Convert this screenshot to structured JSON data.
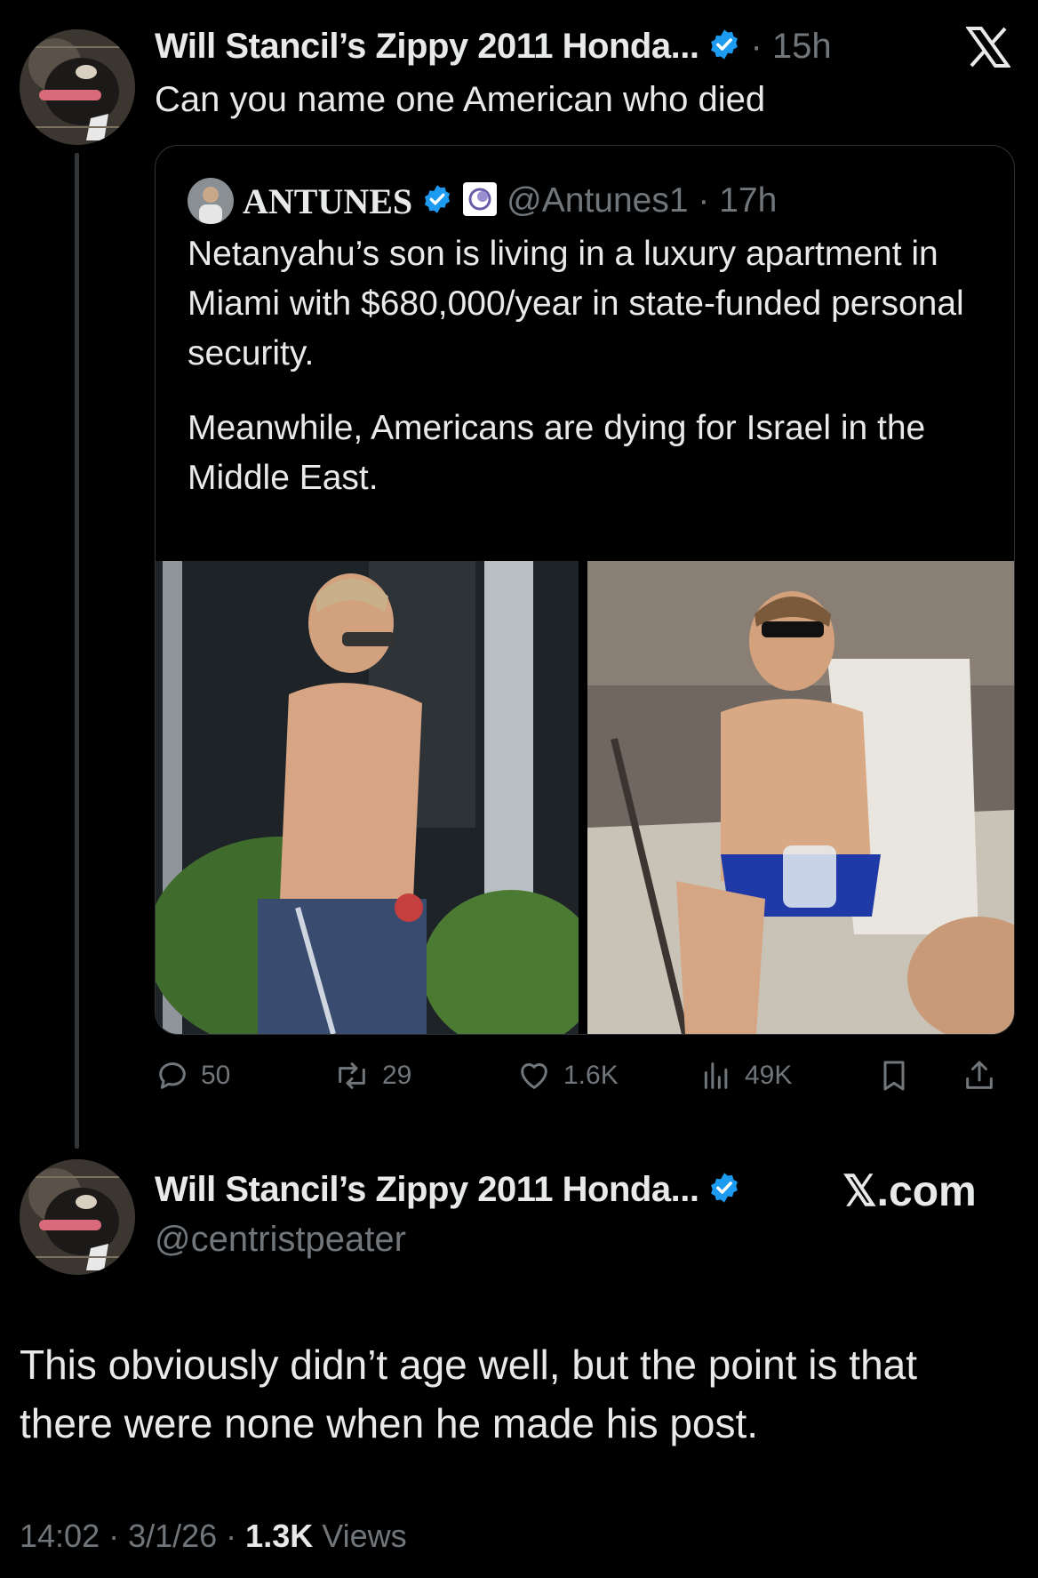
{
  "colors": {
    "background": "#000000",
    "text": "#e7e9ea",
    "muted": "#71767b",
    "verified": "#1d9bf0",
    "border": "#2f3336"
  },
  "top_post": {
    "display_name": "Will Stancil’s Zippy 2011 Honda...",
    "time": "· 15h",
    "text": "Can you name one American who died",
    "brand_icon": "x-logo-icon"
  },
  "quote": {
    "display_name": "ANTUNES",
    "handle_time": "@Antunes1 · 17h",
    "text_1": "Netanyahu’s son is living in a luxury apartment in Miami with $680,000/year in state-funded personal security.",
    "text_2": "Meanwhile, Americans are dying for Israel in the Middle East."
  },
  "actions": {
    "replies": "50",
    "reposts": "29",
    "likes": "1.6K",
    "views": "49K",
    "icons": [
      "reply-icon",
      "repost-icon",
      "like-icon",
      "views-icon",
      "bookmark-icon",
      "share-icon"
    ]
  },
  "main_post": {
    "display_name": "Will Stancil’s Zippy 2011 Honda...",
    "handle": "@centristpeater",
    "brand": "𝕏.com",
    "text": "This obviously didn’t age well, but the point is that there were none when he made his post.",
    "footer_time": "14:02 · 3/1/26 · ",
    "footer_views_count": "1.3K",
    "footer_views_label": " Views"
  }
}
